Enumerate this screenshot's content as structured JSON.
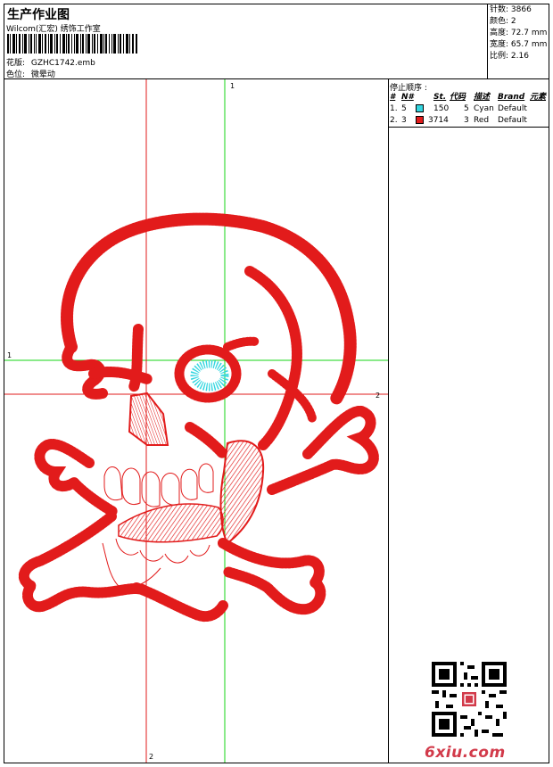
{
  "header": {
    "title": "生产作业图",
    "subtitle": "Wilcom(汇宏) 绣饰工作室",
    "design_label": "花版:",
    "design_value": "GZHC1742.emb",
    "colorway_label": "色位:",
    "colorway_value": "微晕动"
  },
  "stats": {
    "stitches_label": "针数:",
    "stitches_value": "3866",
    "colors_label": "颜色:",
    "colors_value": "2",
    "height_label": "高度:",
    "height_value": "72.7 mm",
    "width_label": "宽度:",
    "width_value": "65.7 mm",
    "ratio_label": "比例:",
    "ratio_value": "2.16"
  },
  "stop_sequence": {
    "title": "停止顺序 :",
    "headers": {
      "num": "#",
      "n": "N#",
      "st": "St.",
      "code": "代码",
      "desc": "描述",
      "brand": "Brand",
      "elem": "元素"
    },
    "rows": [
      {
        "num": "1.",
        "n": "5",
        "swatch_color": "#33d6e0",
        "st": "150",
        "code": "5",
        "desc": "Cyan",
        "brand": "Default"
      },
      {
        "num": "2.",
        "n": "3",
        "swatch_color": "#e21b1b",
        "st": "3714",
        "code": "3",
        "desc": "Red",
        "brand": "Default"
      }
    ]
  },
  "canvas": {
    "axis_labels": {
      "top_green": "1",
      "left_green": "1",
      "right_red": "2",
      "bottom_red": "2"
    },
    "thread_colors": {
      "red": "#e21b1b",
      "cyan": "#33d6e0",
      "green_guide": "#16d616",
      "red_guide": "#e21b1b"
    }
  },
  "watermark": {
    "text": "6xiu.com"
  }
}
